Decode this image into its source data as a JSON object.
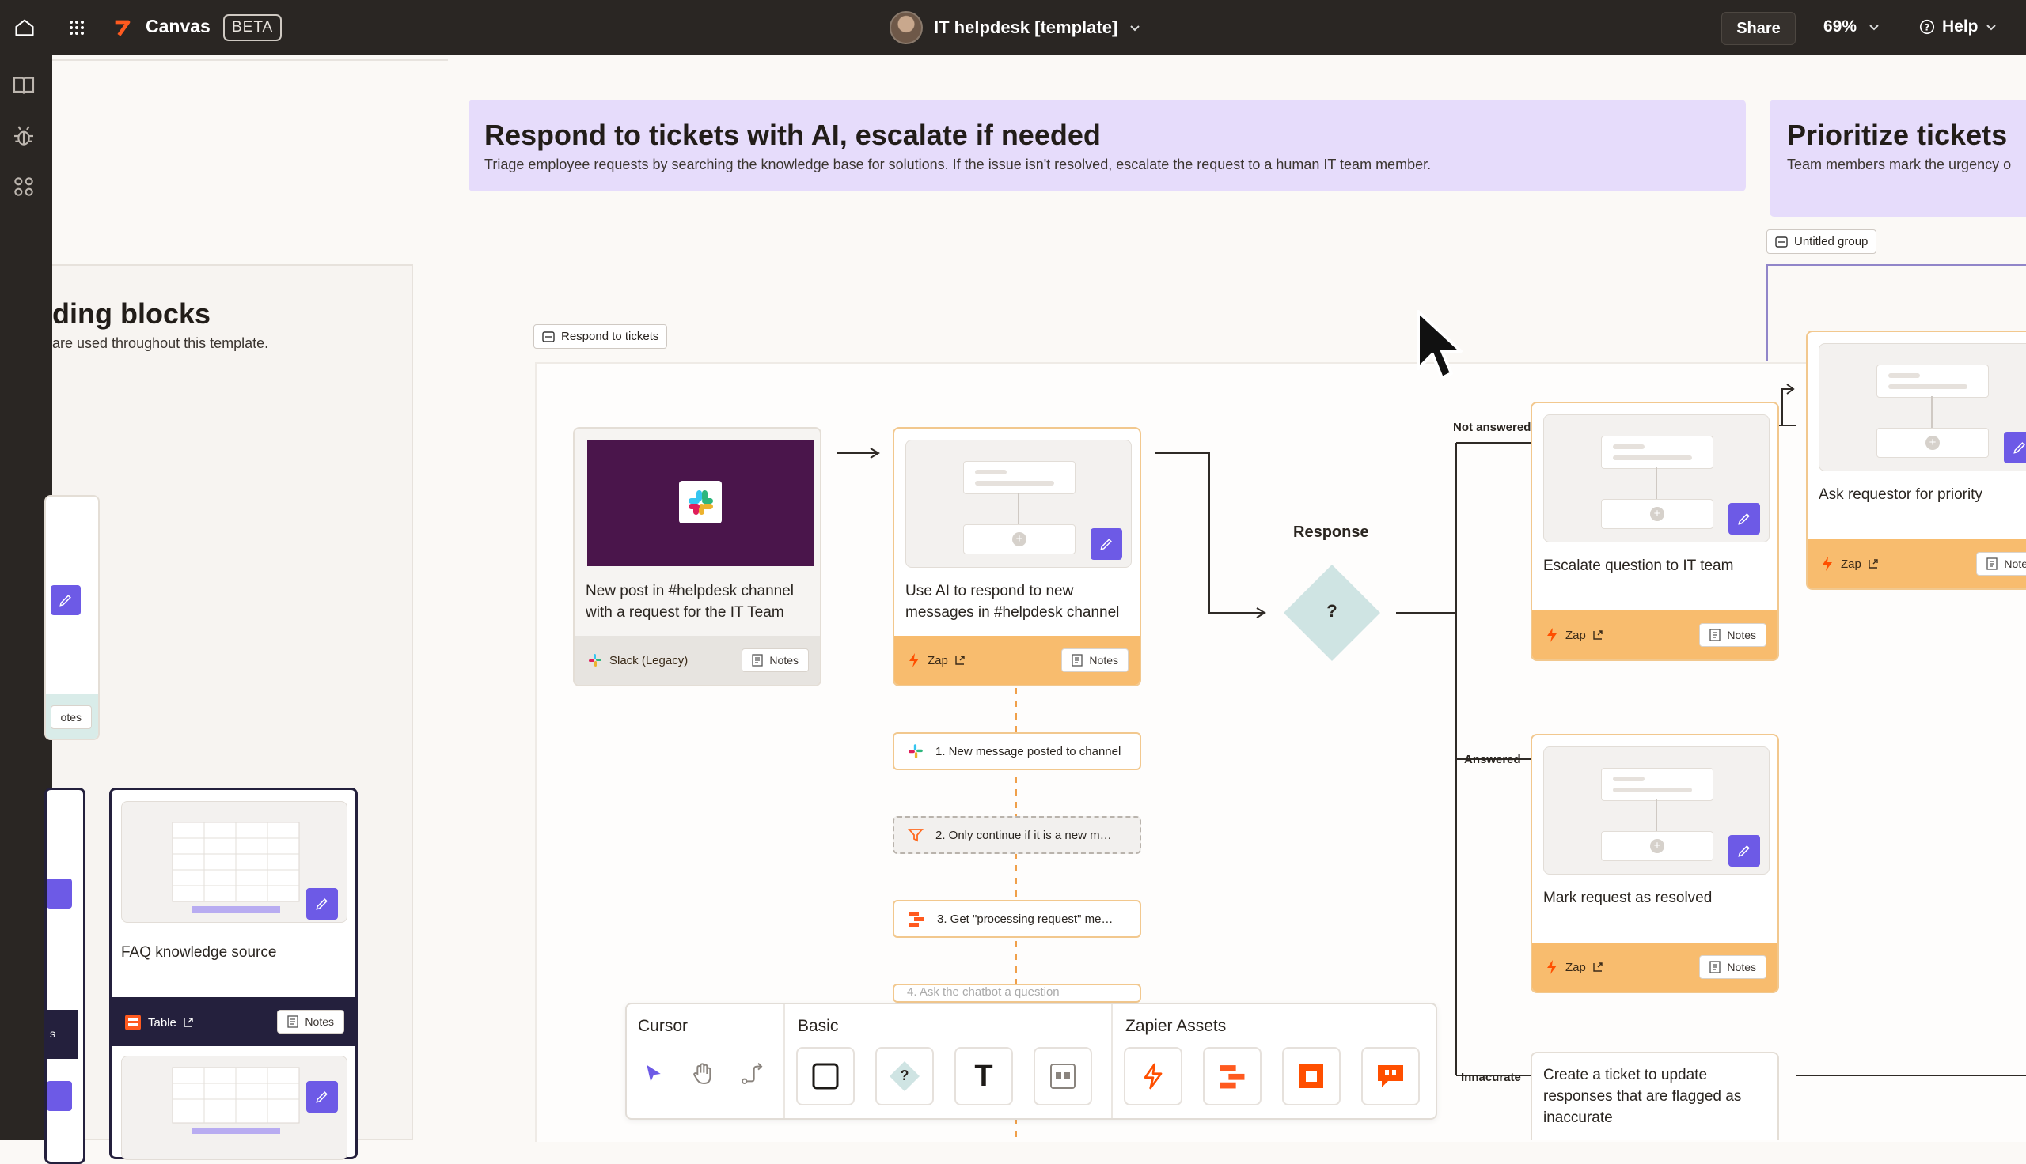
{
  "topbar": {
    "app_name": "Canvas",
    "app_badge": "BETA",
    "canvas_title": "IT helpdesk [template]",
    "share_label": "Share",
    "zoom": "69%",
    "help_label": "Help"
  },
  "sections": {
    "left_title": "ding blocks",
    "left_desc": "are used throughout this template.",
    "main_title": "Respond to tickets with AI, escalate if needed",
    "main_desc": "Triage employee requests by searching the knowledge base for solutions. If the issue isn't resolved, escalate the request to a human IT team member.",
    "right_title": "Prioritize tickets",
    "right_desc": "Team members mark the urgency o"
  },
  "groups": {
    "respond": "Respond to tickets",
    "untitled": "Untitled group"
  },
  "cards": {
    "trigger": {
      "text": "New post in #helpdesk channel with a request for the IT Team",
      "app": "Slack (Legacy)",
      "notes": "Notes"
    },
    "ai_zap": {
      "text": "Use AI to respond to new messages in #helpdesk channel",
      "app": "Zap",
      "notes": "Notes"
    },
    "decision_label": "Response",
    "decision_symbol": "?",
    "escalate": {
      "text": "Escalate question to IT team",
      "app": "Zap",
      "notes": "Notes"
    },
    "resolved": {
      "text": "Mark request as resolved",
      "app": "Zap",
      "notes": "Notes"
    },
    "ticket": {
      "text": "Create a ticket to update responses that are flagged as inaccurate"
    },
    "ask_priority": {
      "text": "Ask requestor for priority",
      "app": "Zap",
      "notes": "Note"
    },
    "faq": {
      "text": "FAQ knowledge source",
      "app": "Table",
      "notes": "Notes"
    },
    "left_partial": {
      "notes": "otes",
      "app": "s"
    }
  },
  "steps": [
    "1. New message posted to channel",
    "2. Only continue if it is a new m…",
    "3. Get \"processing request\" me…",
    "4. Ask the chatbot a question"
  ],
  "branches": {
    "not_answered": "Not answered",
    "answered": "Answered",
    "inaccurate": "Innacurate"
  },
  "toolbar": {
    "cursor_label": "Cursor",
    "basic_label": "Basic",
    "assets_label": "Zapier Assets",
    "text_tool": "T",
    "decision_tool": "?"
  },
  "colors": {
    "accent_purple": "#6d5ae6",
    "zap_orange": "#f8bc6e",
    "header_lavender": "#e6dcfb",
    "slack_purple": "#4a154b"
  }
}
